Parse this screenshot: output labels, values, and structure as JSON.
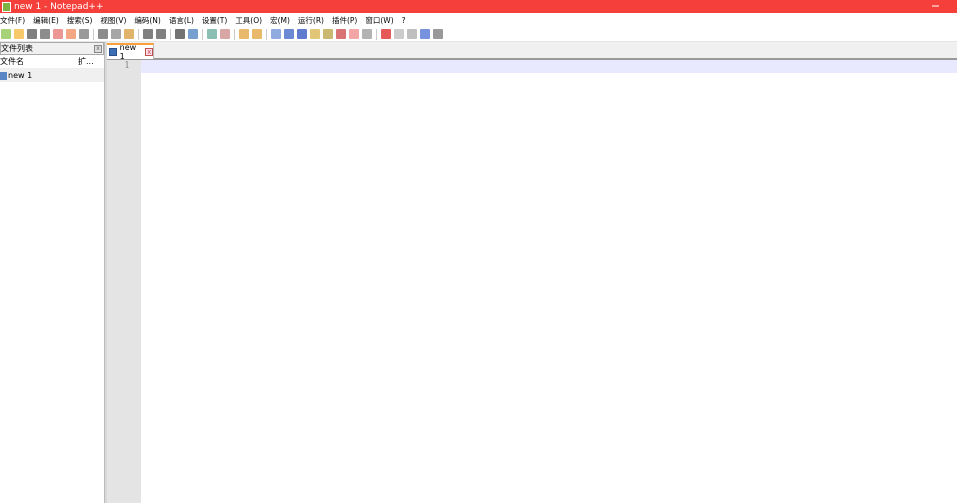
{
  "window": {
    "title": "new 1 - Notepad++"
  },
  "menu": [
    "文件(F)",
    "编辑(E)",
    "搜索(S)",
    "视图(V)",
    "编码(N)",
    "语言(L)",
    "设置(T)",
    "工具(O)",
    "宏(M)",
    "运行(R)",
    "插件(P)",
    "窗口(W)",
    "?"
  ],
  "toolbar": {
    "icons": [
      "new-file",
      "open-file",
      "save",
      "save-all",
      "close",
      "close-all",
      "print",
      "cut",
      "copy",
      "paste",
      "undo",
      "redo",
      "find",
      "replace",
      "zoom-in",
      "zoom-out",
      "sync-vertical",
      "sync-horizontal",
      "word-wrap",
      "show-all-chars",
      "indent-guide",
      "udl",
      "doc-map",
      "function-list",
      "folder-workspace",
      "monitoring",
      "record-macro",
      "stop-record",
      "play-macro",
      "run-macro-multiple",
      "save-macro"
    ]
  },
  "panel": {
    "title": "文件列表",
    "close": "x",
    "col_name": "文件名",
    "col_ext": "扩...",
    "files": [
      "new 1"
    ]
  },
  "tabs": [
    {
      "label": "new 1",
      "close": "x"
    }
  ],
  "editor": {
    "line_numbers": [
      "1"
    ],
    "content": ""
  }
}
